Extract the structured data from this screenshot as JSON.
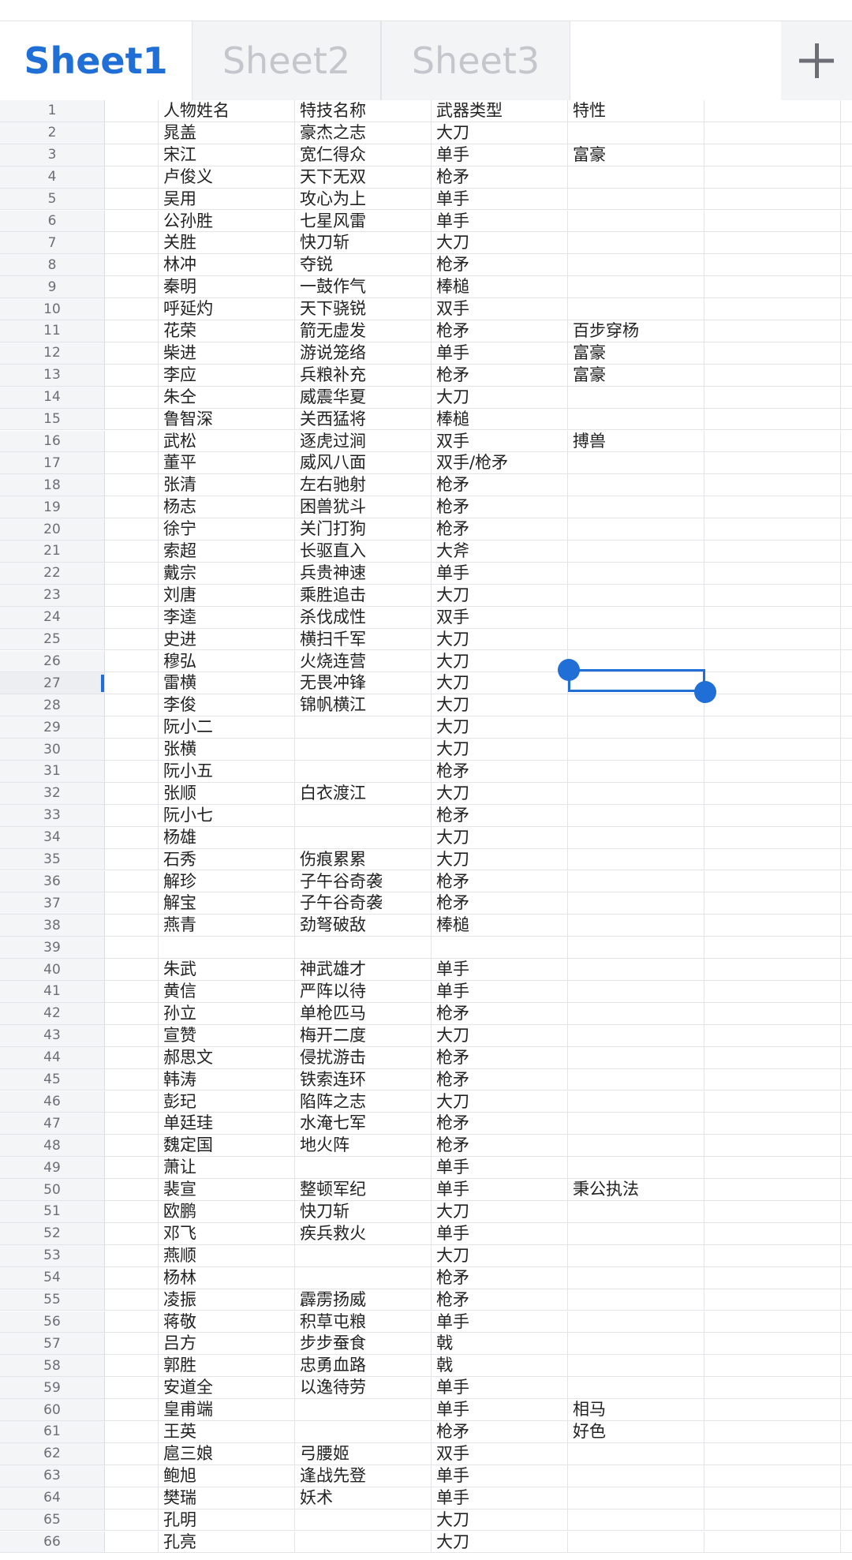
{
  "tabs": [
    {
      "label": "Sheet1",
      "active": true
    },
    {
      "label": "Sheet2",
      "active": false
    },
    {
      "label": "Sheet3",
      "active": false
    }
  ],
  "add_tab_icon": "plus-icon",
  "accent_color": "#1f6fd6",
  "selected_cell": {
    "row": 27,
    "column": "E"
  },
  "rows": [
    [
      "1",
      "人物姓名",
      "特技名称",
      "武器类型",
      "特性"
    ],
    [
      "2",
      "晁盖",
      "豪杰之志",
      "大刀",
      ""
    ],
    [
      "3",
      "宋江",
      "宽仁得众",
      "单手",
      "富豪"
    ],
    [
      "4",
      "卢俊义",
      "天下无双",
      "枪矛",
      ""
    ],
    [
      "5",
      "吴用",
      "攻心为上",
      "单手",
      ""
    ],
    [
      "6",
      "公孙胜",
      "七星风雷",
      "单手",
      ""
    ],
    [
      "7",
      "关胜",
      "快刀斩",
      "大刀",
      ""
    ],
    [
      "8",
      "林冲",
      "夺锐",
      "枪矛",
      ""
    ],
    [
      "9",
      "秦明",
      "一鼓作气",
      "棒槌",
      ""
    ],
    [
      "10",
      "呼延灼",
      "天下骁锐",
      "双手",
      ""
    ],
    [
      "11",
      "花荣",
      "箭无虚发",
      "枪矛",
      "百步穿杨"
    ],
    [
      "12",
      "柴进",
      "游说笼络",
      "单手",
      "富豪"
    ],
    [
      "13",
      "李应",
      "兵粮补充",
      "枪矛",
      "富豪"
    ],
    [
      "14",
      "朱仝",
      "威震华夏",
      "大刀",
      ""
    ],
    [
      "15",
      "鲁智深",
      "关西猛将",
      "棒槌",
      ""
    ],
    [
      "16",
      "武松",
      "逐虎过涧",
      "双手",
      "搏兽"
    ],
    [
      "17",
      "董平",
      "威风八面",
      "双手/枪矛",
      ""
    ],
    [
      "18",
      "张清",
      "左右驰射",
      "枪矛",
      ""
    ],
    [
      "19",
      "杨志",
      "困兽犹斗",
      "枪矛",
      ""
    ],
    [
      "20",
      "徐宁",
      "关门打狗",
      "枪矛",
      ""
    ],
    [
      "21",
      "索超",
      "长驱直入",
      "大斧",
      ""
    ],
    [
      "22",
      "戴宗",
      "兵贵神速",
      "单手",
      ""
    ],
    [
      "23",
      "刘唐",
      "乘胜追击",
      "大刀",
      ""
    ],
    [
      "24",
      "李逵",
      "杀伐成性",
      "双手",
      ""
    ],
    [
      "25",
      "史进",
      "横扫千军",
      "大刀",
      ""
    ],
    [
      "26",
      "穆弘",
      "火烧连营",
      "大刀",
      ""
    ],
    [
      "27",
      "雷横",
      "无畏冲锋",
      "大刀",
      ""
    ],
    [
      "28",
      "李俊",
      "锦帆横江",
      "大刀",
      ""
    ],
    [
      "29",
      "阮小二",
      "",
      "大刀",
      ""
    ],
    [
      "30",
      "张横",
      "",
      "大刀",
      ""
    ],
    [
      "31",
      "阮小五",
      "",
      "枪矛",
      ""
    ],
    [
      "32",
      "张顺",
      "白衣渡江",
      "大刀",
      ""
    ],
    [
      "33",
      "阮小七",
      "",
      "枪矛",
      ""
    ],
    [
      "34",
      "杨雄",
      "",
      "大刀",
      ""
    ],
    [
      "35",
      "石秀",
      "伤痕累累",
      "大刀",
      ""
    ],
    [
      "36",
      "解珍",
      "子午谷奇袭",
      "枪矛",
      ""
    ],
    [
      "37",
      "解宝",
      "子午谷奇袭",
      "枪矛",
      ""
    ],
    [
      "38",
      "燕青",
      "劲弩破敌",
      "棒槌",
      ""
    ],
    [
      "39",
      "",
      "",
      "",
      ""
    ],
    [
      "40",
      "朱武",
      "神武雄才",
      "单手",
      ""
    ],
    [
      "41",
      "黄信",
      "严阵以待",
      "单手",
      ""
    ],
    [
      "42",
      "孙立",
      "单枪匹马",
      "枪矛",
      ""
    ],
    [
      "43",
      "宣赞",
      "梅开二度",
      "大刀",
      ""
    ],
    [
      "44",
      "郝思文",
      "侵扰游击",
      "枪矛",
      ""
    ],
    [
      "45",
      "韩涛",
      "铁索连环",
      "枪矛",
      ""
    ],
    [
      "46",
      "彭玘",
      "陷阵之志",
      "大刀",
      ""
    ],
    [
      "47",
      "单廷珪",
      "水淹七军",
      "枪矛",
      ""
    ],
    [
      "48",
      "魏定国",
      "地火阵",
      "枪矛",
      ""
    ],
    [
      "49",
      "萧让",
      "",
      "单手",
      ""
    ],
    [
      "50",
      "裴宣",
      "整顿军纪",
      "单手",
      "秉公执法"
    ],
    [
      "51",
      "欧鹏",
      "快刀斩",
      "大刀",
      ""
    ],
    [
      "52",
      "邓飞",
      "疾兵救火",
      "单手",
      ""
    ],
    [
      "53",
      "燕顺",
      "",
      "大刀",
      ""
    ],
    [
      "54",
      "杨林",
      "",
      "枪矛",
      ""
    ],
    [
      "55",
      "凌振",
      "霹雳扬威",
      "枪矛",
      ""
    ],
    [
      "56",
      "蒋敬",
      "积草屯粮",
      "单手",
      ""
    ],
    [
      "57",
      "吕方",
      "步步蚕食",
      "戟",
      ""
    ],
    [
      "58",
      "郭胜",
      "忠勇血路",
      "戟",
      ""
    ],
    [
      "59",
      "安道全",
      "以逸待劳",
      "单手",
      ""
    ],
    [
      "60",
      "皇甫端",
      "",
      "单手",
      "相马"
    ],
    [
      "61",
      "王英",
      "",
      "枪矛",
      "好色"
    ],
    [
      "62",
      "扈三娘",
      "弓腰姬",
      "双手",
      ""
    ],
    [
      "63",
      "鲍旭",
      "逢战先登",
      "单手",
      ""
    ],
    [
      "64",
      "樊瑞",
      "妖术",
      "单手",
      ""
    ],
    [
      "65",
      "孔明",
      "",
      "大刀",
      ""
    ],
    [
      "66",
      "孔亮",
      "",
      "大刀",
      ""
    ]
  ]
}
